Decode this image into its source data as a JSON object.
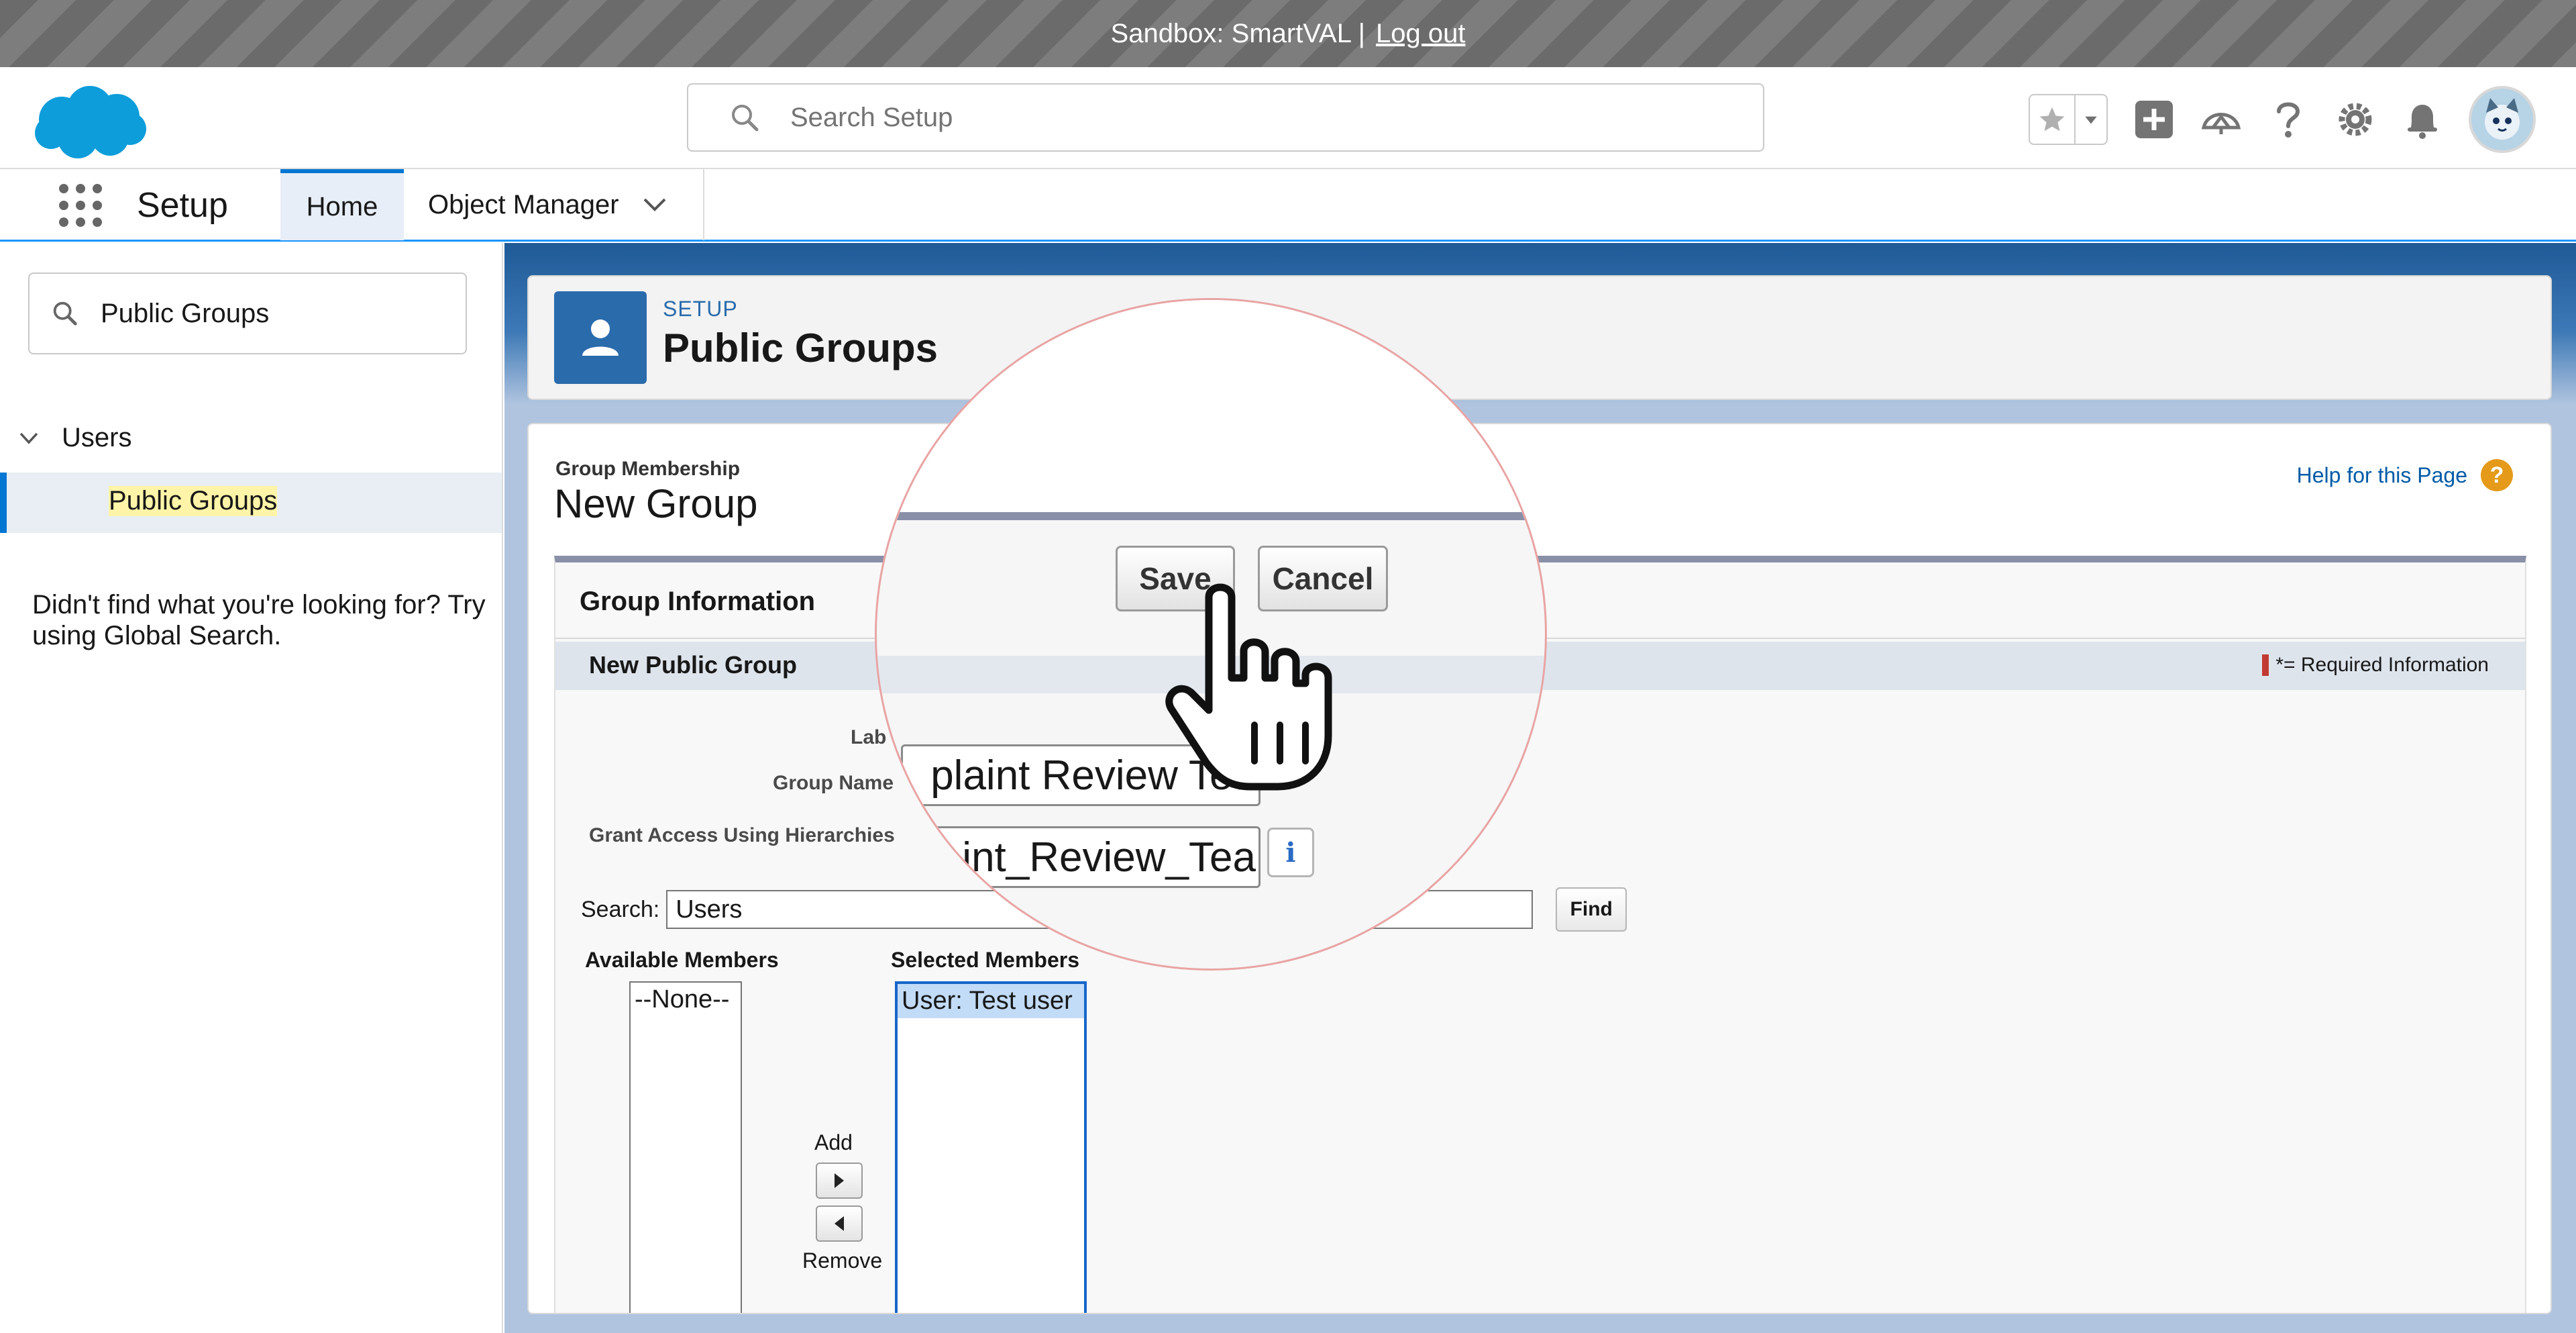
{
  "banner": {
    "text": "Sandbox: SmartVAL |",
    "logout": "Log out"
  },
  "header": {
    "search_placeholder": "Search Setup"
  },
  "appnav": {
    "app_name": "Setup",
    "tabs": [
      {
        "label": "Home",
        "active": true
      },
      {
        "label": "Object Manager"
      }
    ]
  },
  "sidebar": {
    "quick_find_value": "Public Groups",
    "tree": {
      "parent": "Users",
      "child": "Public Groups"
    },
    "not_found_text": "Didn't find what you're looking for? Try using Global Search."
  },
  "page_header": {
    "subtitle": "SETUP",
    "title": "Public Groups"
  },
  "form": {
    "section_label": "Group Membership",
    "title": "New Group",
    "help_link": "Help for this Page",
    "help_icon": "?",
    "block_title": "Group Information",
    "subsection_title": "New Public Group",
    "required_legend": "*= Required Information",
    "label_field_label": "Lab",
    "group_name_label": "Group Name",
    "grant_access_label": "Grant Access Using Hierarchies",
    "search_label": "Search:",
    "search_value": "Users",
    "find_button": "Find",
    "available_members_label": "Available Members",
    "selected_members_label": "Selected Members",
    "available_options": [
      "--None--"
    ],
    "selected_options": [
      "User: Test user"
    ],
    "add_label": "Add",
    "remove_label": "Remove"
  },
  "magnifier": {
    "save_button": "Save",
    "cancel_button": "Cancel",
    "label_value": "plaint Review Tea",
    "group_name_value": "int_Review_Tea",
    "info_icon": "i"
  },
  "colors": {
    "brand_blue": "#0176d3",
    "salesforce_cloud": "#0d9dda",
    "highlight": "#fff4a8",
    "required_red": "#c23934"
  },
  "icons": [
    "salesforce-logo-icon",
    "search-icon",
    "star-icon",
    "chevron-down-icon",
    "plus-icon",
    "trailhead-icon",
    "help-icon",
    "gear-icon",
    "bell-icon",
    "avatar-icon",
    "app-launcher-icon",
    "user-icon",
    "cursor-hand-icon"
  ]
}
